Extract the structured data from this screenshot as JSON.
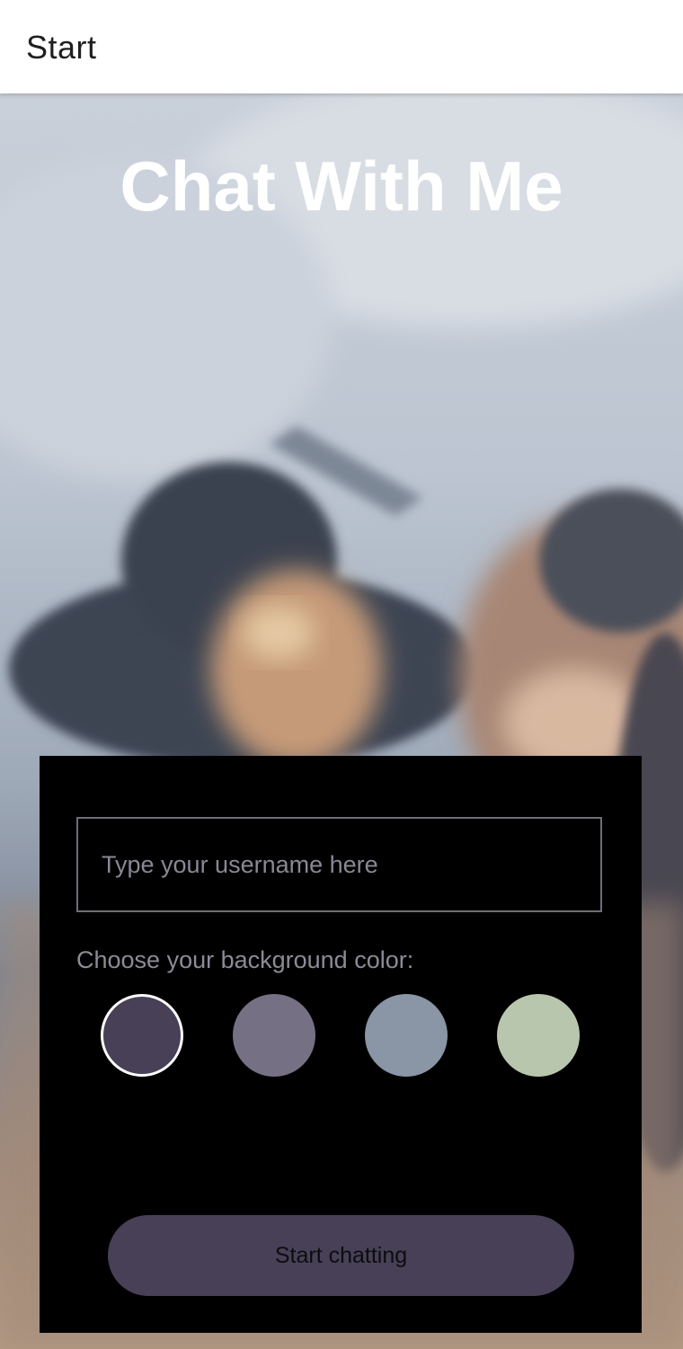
{
  "header": {
    "title": "Start"
  },
  "hero": {
    "title": "Chat With Me"
  },
  "form": {
    "username_placeholder": "Type your username here",
    "username_value": "",
    "color_label": "Choose your background color:",
    "colors": [
      {
        "name": "dark-purple",
        "hex": "#474056",
        "selected": true
      },
      {
        "name": "gray-purple",
        "hex": "#757083",
        "selected": false
      },
      {
        "name": "slate-blue",
        "hex": "#8A95A5",
        "selected": false
      },
      {
        "name": "sage-green",
        "hex": "#B9C6AE",
        "selected": false
      }
    ],
    "start_button_label": "Start chatting",
    "start_button_color": "#474056"
  },
  "colors": {
    "panel_bg": "#000000",
    "header_bg": "#ffffff",
    "title_text": "#ffffff"
  }
}
